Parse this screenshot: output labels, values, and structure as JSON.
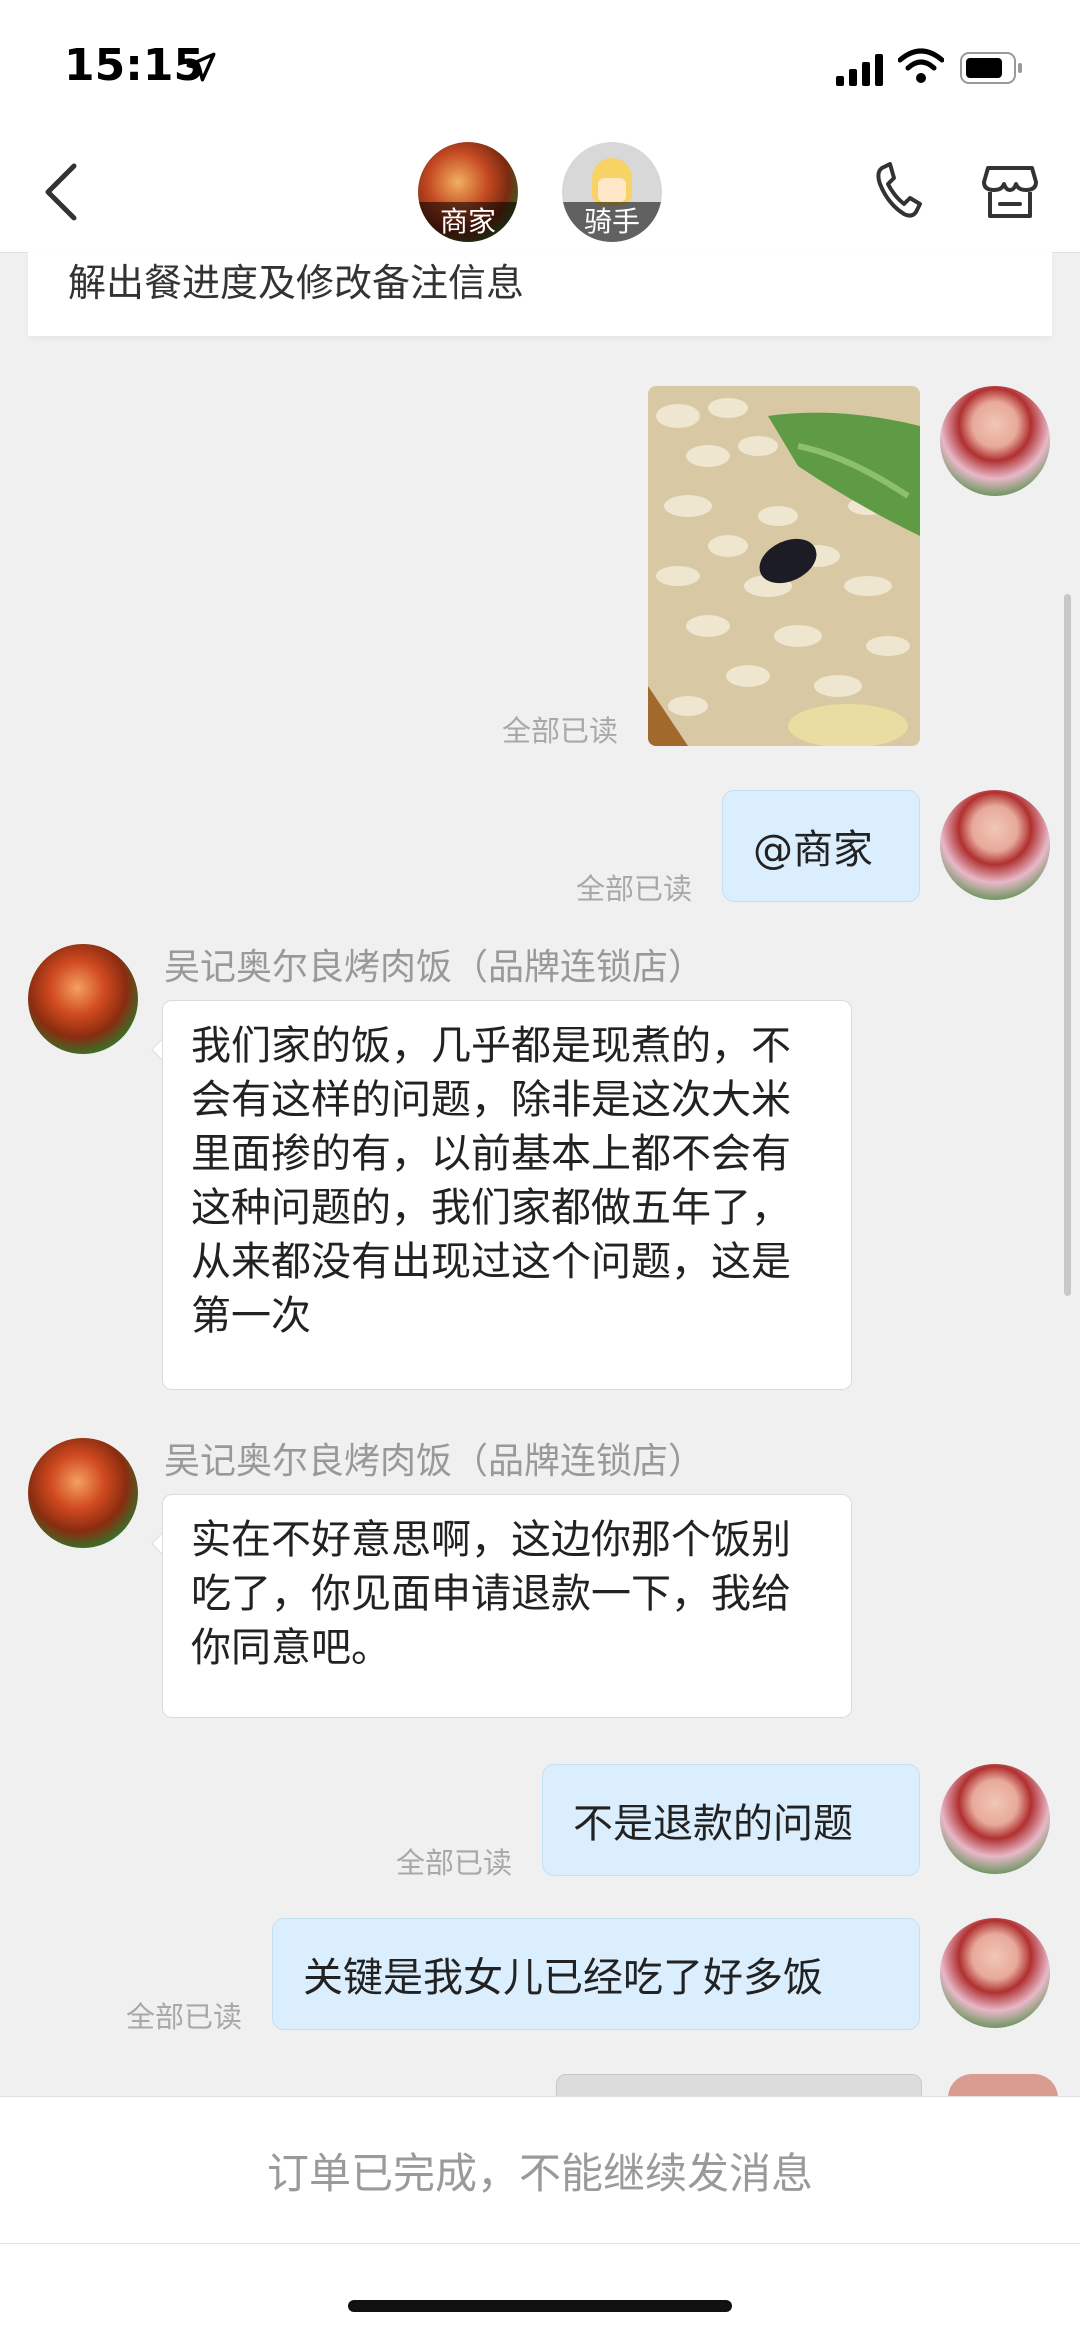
{
  "status_bar": {
    "time": "15:15"
  },
  "header": {
    "merchant_tag": "商家",
    "rider_tag": "骑手"
  },
  "notice_text": "解出餐进度及修改备注信息",
  "messages": {
    "read_label": "全部已读",
    "me_mention": "@商家",
    "shop_name": "吴记奥尔良烤肉饭（品牌连锁店）",
    "shop_msg1": "我们家的饭，几乎都是现煮的，不会有这样的问题，除非是这次大米里面掺的有，以前基本上都不会有这种问题的，我们家都做五年了，从来都没有出现过这个问题，这是第一次",
    "shop_msg2": "实在不好意思啊，这边你那个饭别吃了，你见面申请退款一下，我给你同意吧。",
    "me_msg2": "不是退款的问题",
    "me_msg3": "关键是我女儿已经吃了好多饭"
  },
  "footer": {
    "disabled_text": "订单已完成，不能继续发消息"
  },
  "colors": {
    "my_bubble": "#dbeefd",
    "background": "#f0f0f0"
  }
}
